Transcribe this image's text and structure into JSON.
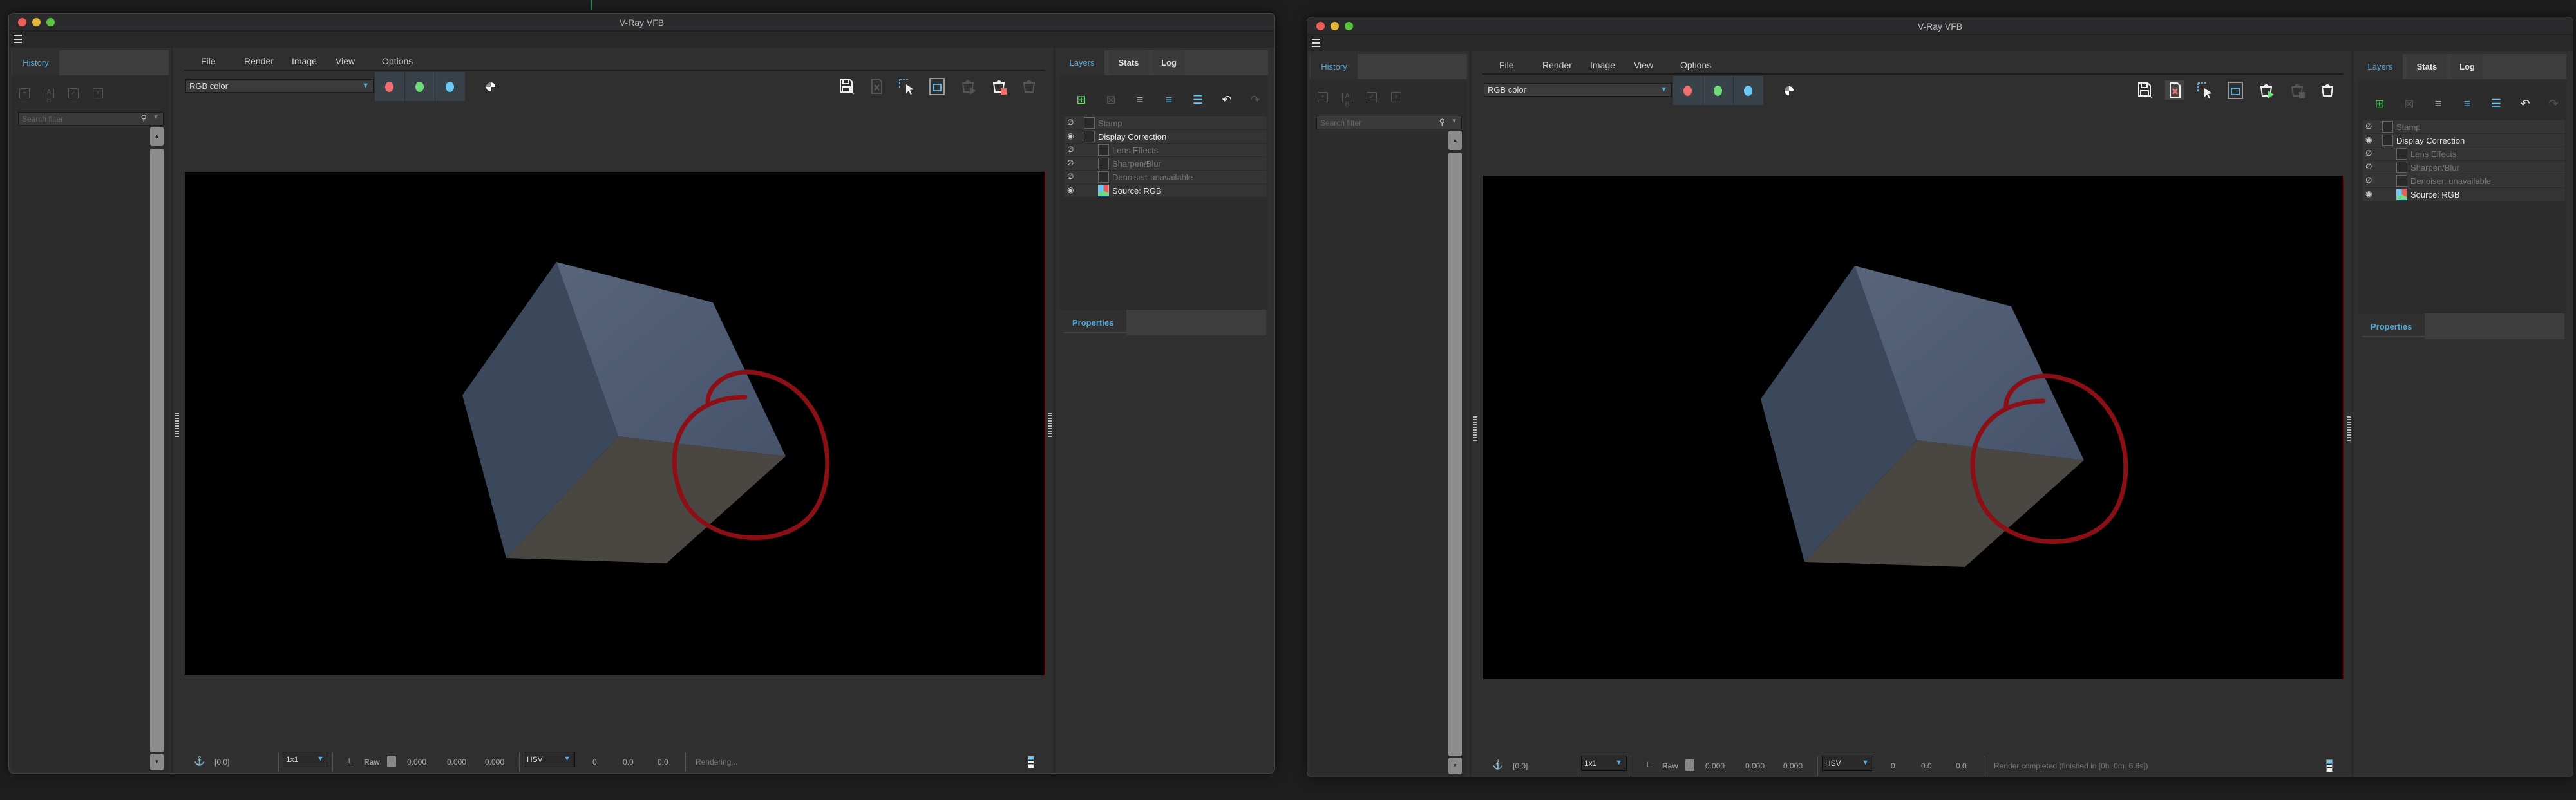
{
  "windows": [
    {
      "title": "V-Ray VFB",
      "history_tab": "History",
      "search_placeholder": "Search filter",
      "menu": [
        "File",
        "Render",
        "Image",
        "View",
        "Options"
      ],
      "channel": "RGB color",
      "right_tabs": [
        "Layers",
        "Stats",
        "Log"
      ],
      "layers": [
        {
          "label": "Stamp",
          "visible": false,
          "enabled": false
        },
        {
          "label": "Display Correction",
          "visible": true,
          "enabled": true
        },
        {
          "label": "Lens Effects",
          "visible": false,
          "enabled": false
        },
        {
          "label": "Sharpen/Blur",
          "visible": false,
          "enabled": false
        },
        {
          "label": "Denoiser: unavailable",
          "visible": false,
          "enabled": false
        },
        {
          "label": "Source: RGB",
          "visible": true,
          "enabled": true
        }
      ],
      "properties_label": "Properties",
      "status": {
        "coords": "[0,0]",
        "zoom": "1x1",
        "raw_label": "Raw",
        "rgb": [
          "0.000",
          "0.000",
          "0.000"
        ],
        "color_mode": "HSV",
        "hsv": [
          "0",
          "0.0",
          "0.0"
        ],
        "message": "Rendering..."
      },
      "toolbar_state": {
        "clear_active": false,
        "render_state": "stop"
      }
    },
    {
      "title": "V-Ray VFB",
      "history_tab": "History",
      "search_placeholder": "Search filter",
      "menu": [
        "File",
        "Render",
        "Image",
        "View",
        "Options"
      ],
      "channel": "RGB color",
      "right_tabs": [
        "Layers",
        "Stats",
        "Log"
      ],
      "layers": [
        {
          "label": "Stamp",
          "visible": false,
          "enabled": false
        },
        {
          "label": "Display Correction",
          "visible": true,
          "enabled": true
        },
        {
          "label": "Lens Effects",
          "visible": false,
          "enabled": false
        },
        {
          "label": "Sharpen/Blur",
          "visible": false,
          "enabled": false
        },
        {
          "label": "Denoiser: unavailable",
          "visible": false,
          "enabled": false
        },
        {
          "label": "Source: RGB",
          "visible": true,
          "enabled": true
        }
      ],
      "properties_label": "Properties",
      "status": {
        "coords": "[0,0]",
        "zoom": "1x1",
        "raw_label": "Raw",
        "rgb": [
          "0.000",
          "0.000",
          "0.000"
        ],
        "color_mode": "HSV",
        "hsv": [
          "0",
          "0.0",
          "0.0"
        ],
        "message": "Render completed (finished in [0h  0m  6.6s])"
      },
      "toolbar_state": {
        "clear_active": true,
        "render_state": "start"
      }
    }
  ],
  "colors": {
    "accent": "#4fa7d8",
    "red_channel": "#f07070",
    "green_channel": "#6fdc7a",
    "blue_channel": "#6cc8f5",
    "annotation": "#8b0f14"
  }
}
